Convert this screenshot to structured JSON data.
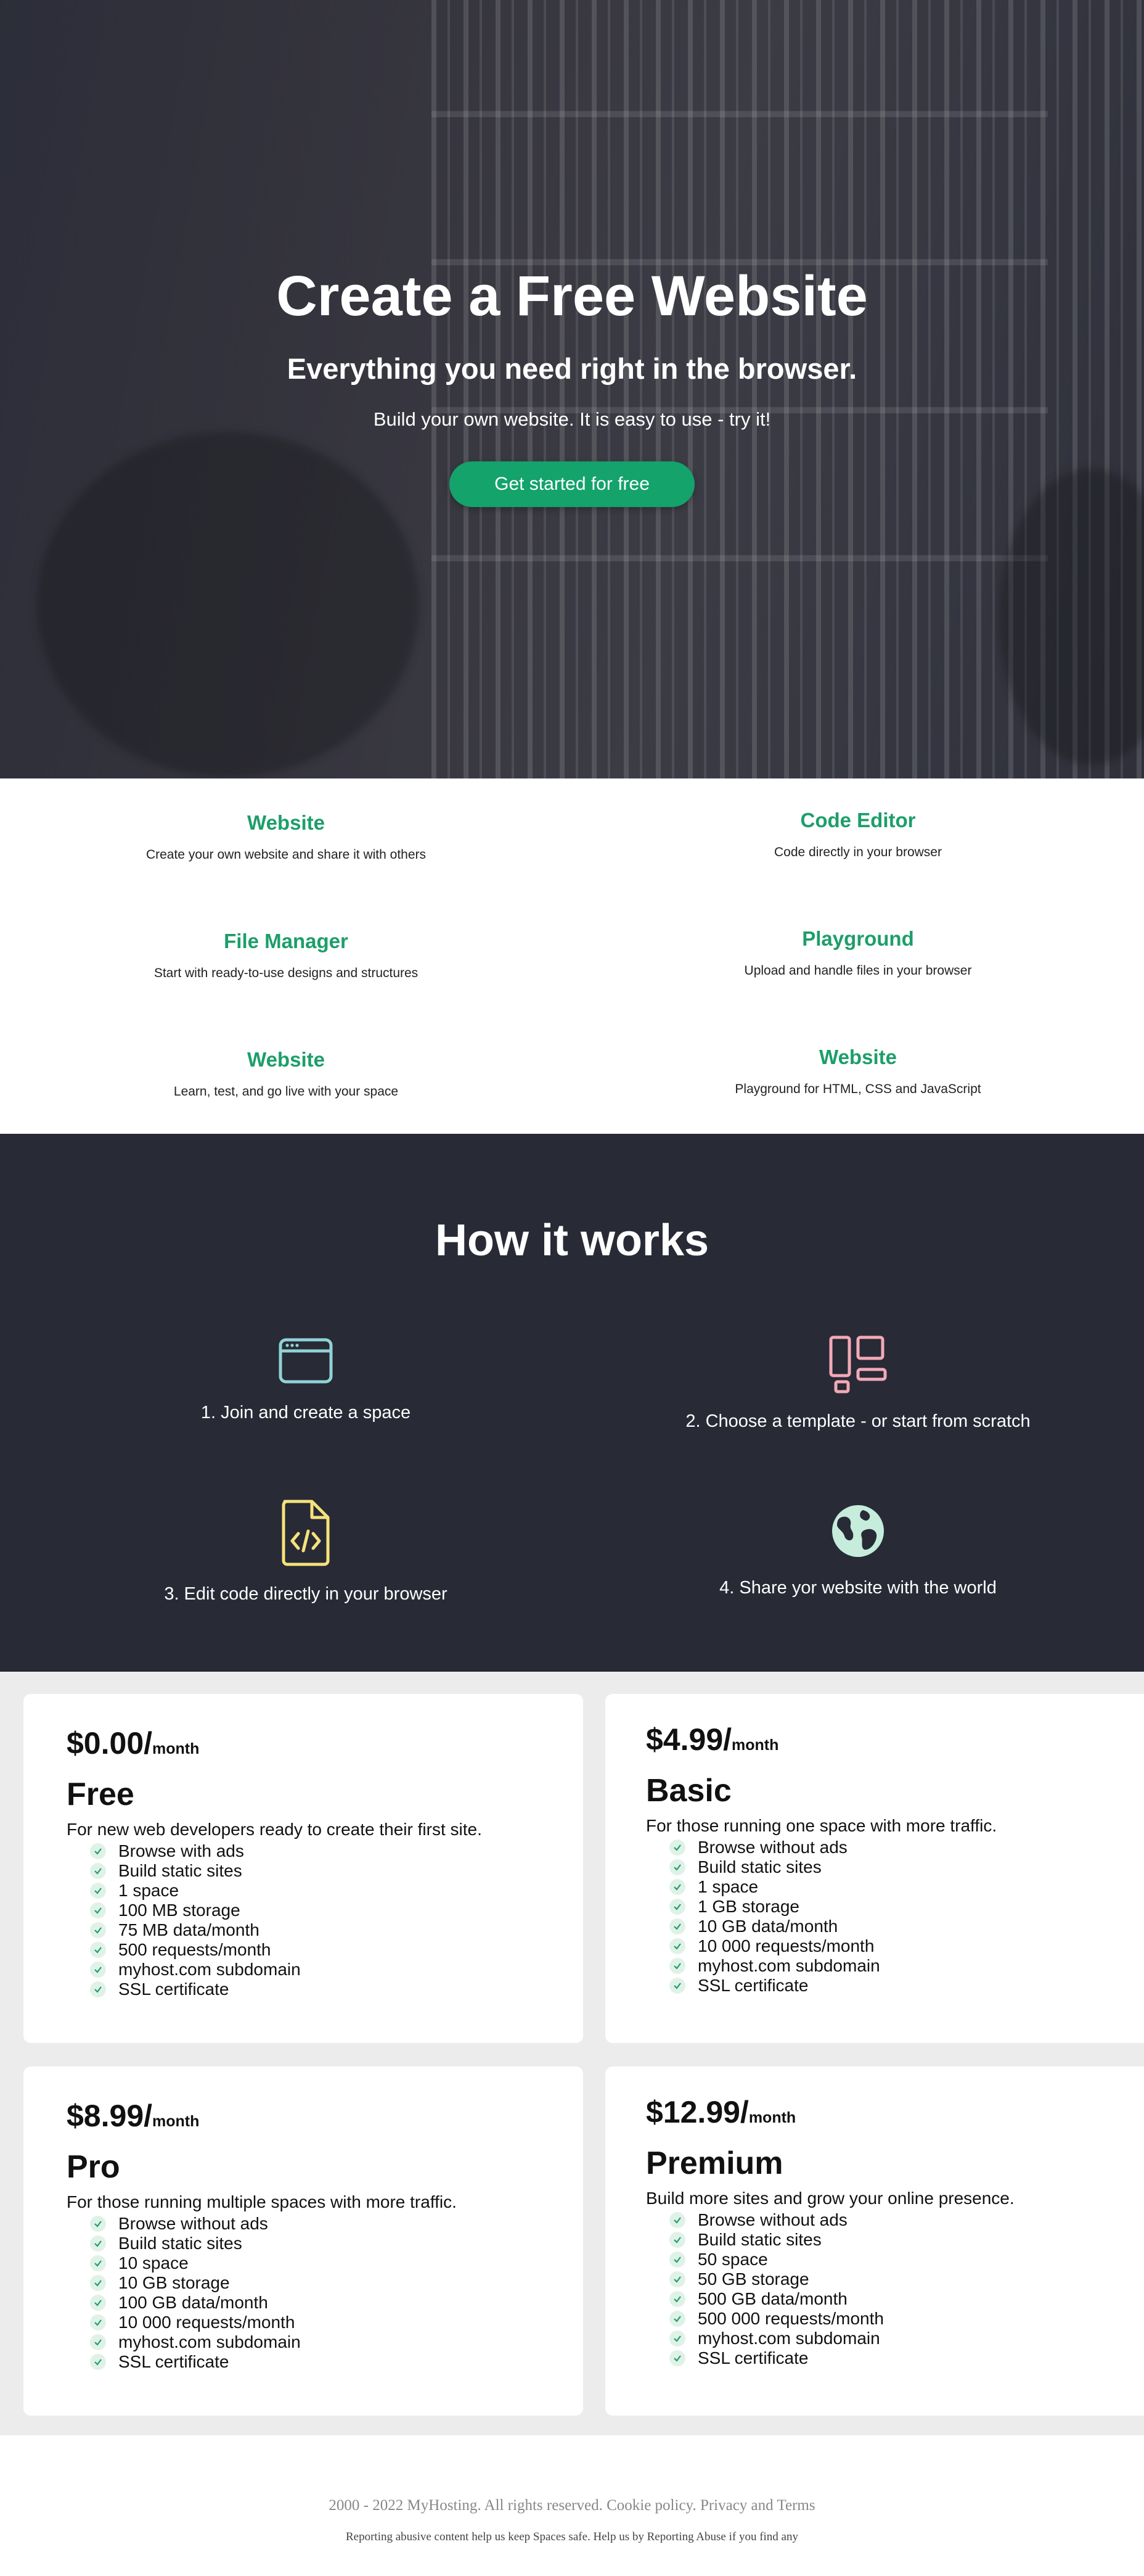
{
  "hero": {
    "title": "Create a Free Website",
    "subtitle": "Everything you need right in the browser.",
    "tagline": "Build your own website. It is easy to use - try it!",
    "cta_label": "Get started for free"
  },
  "features": [
    {
      "title": "Website",
      "text": "Create your own website and share it with others"
    },
    {
      "title": "Code Editor",
      "text": "Code directly in your browser"
    },
    {
      "title": "File Manager",
      "text": "Start with ready-to-use designs and structures"
    },
    {
      "title": "Playground",
      "text": "Upload and handle files in your browser"
    },
    {
      "title": "Website",
      "text": "Learn, test, and go live with your space"
    },
    {
      "title": "Website",
      "text": "Playground for HTML, CSS and JavaScript"
    }
  ],
  "how": {
    "title": "How it works",
    "steps": [
      {
        "label": "1. Join and create a space",
        "icon": "browser-window-icon",
        "color": "#8fd3d6"
      },
      {
        "label": "2. Choose a template - or start from scratch",
        "icon": "layout-template-icon",
        "color": "#f2a9b6"
      },
      {
        "label": "3. Edit code directly in your browser",
        "icon": "code-file-icon",
        "color": "#f5e27a"
      },
      {
        "label": "4. Share yor website with the world",
        "icon": "globe-icon",
        "color": "#c6ecdc"
      }
    ]
  },
  "pricing": {
    "unit": "month",
    "plans": [
      {
        "price": "$0.00/",
        "name": "Free",
        "description": "For new web developers ready to create their first site.",
        "features": [
          "Browse with ads",
          "Build static sites",
          "1 space",
          "100 MB storage",
          "75 MB data/month",
          "500 requests/month",
          "myhost.com subdomain",
          "SSL certificate"
        ]
      },
      {
        "price": "$4.99/",
        "name": "Basic",
        "description": "For those running one space with more traffic.",
        "features": [
          "Browse without ads",
          "Build static sites",
          "1 space",
          "1 GB storage",
          "10 GB data/month",
          "10 000 requests/month",
          "myhost.com subdomain",
          "SSL certificate"
        ]
      },
      {
        "price": "$8.99/",
        "name": "Pro",
        "description": "For those running multiple spaces with more traffic.",
        "features": [
          "Browse without ads",
          "Build static sites",
          "10 space",
          "10 GB storage",
          "100 GB data/month",
          "10 000 requests/month",
          "myhost.com subdomain",
          "SSL certificate"
        ]
      },
      {
        "price": "$12.99/",
        "name": "Premium",
        "description": "Build more sites and grow your online presence.",
        "features": [
          "Browse without ads",
          "Build static sites",
          "50 space",
          "50 GB storage",
          "500 GB data/month",
          "500 000 requests/month",
          "myhost.com subdomain",
          "SSL certificate"
        ]
      }
    ]
  },
  "footer": {
    "copyright": "2000 - 2022 MyHosting. All rights reserved.",
    "cookie_link": "Cookie policy.",
    "privacy_link": "Privacy and Terms",
    "abuse_text": "Reporting abusive content help us keep Spaces safe. Help us by Reporting Abuse if you find any"
  },
  "colors": {
    "accent": "#13a36b",
    "feature_title": "#1d9e6a",
    "dark_section": "#282a36",
    "pricing_bg": "#ececec"
  }
}
